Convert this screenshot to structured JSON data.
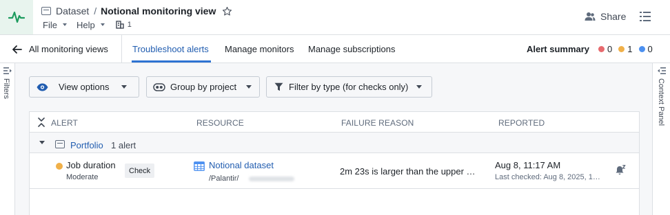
{
  "header": {
    "breadcrumb_parent": "Dataset",
    "breadcrumb_separator": "/",
    "title": "Notional monitoring view",
    "menus": [
      "File",
      "Help"
    ],
    "branch_count": "1",
    "share_label": "Share"
  },
  "tabbar": {
    "back_label": "All monitoring views",
    "tabs": [
      "Troubleshoot alerts",
      "Manage monitors",
      "Manage subscriptions"
    ],
    "active_tab": "Troubleshoot alerts",
    "alert_summary": {
      "label": "Alert summary",
      "counts": [
        {
          "severity": "critical",
          "value": "0",
          "color": "#e76a6e"
        },
        {
          "severity": "moderate",
          "value": "1",
          "color": "#f0b049"
        },
        {
          "severity": "low",
          "value": "0",
          "color": "#4c90f0"
        }
      ]
    }
  },
  "rails": {
    "left_label": "Filters",
    "right_label": "Context Panel"
  },
  "toolbar": {
    "view_options": "View options",
    "group_by": "Group by project",
    "filter_by_type": "Filter by type (for checks only)"
  },
  "table": {
    "headers": [
      "ALERT",
      "RESOURCE",
      "FAILURE REASON",
      "REPORTED"
    ],
    "group": {
      "name": "Portfolio",
      "count": "1 alert"
    },
    "rows": [
      {
        "alert": "Job duration",
        "severity": "Moderate",
        "severity_color": "#f0b049",
        "type": "Check",
        "resource": "Notional dataset",
        "resource_path": "/Palantir/",
        "failure_reason": "2m 23s is larger than the upper …",
        "reported": "Aug 8, 11:17 AM",
        "last_checked": "Last checked: Aug 8, 2025, 1…"
      }
    ]
  },
  "colors": {
    "accent": "#215db0",
    "brand_green": "#1c9b5e"
  }
}
